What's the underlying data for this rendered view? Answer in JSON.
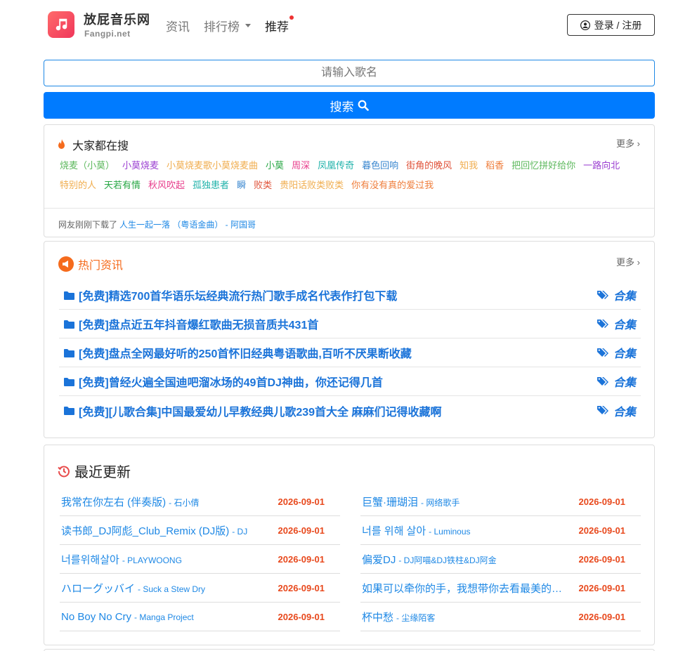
{
  "header": {
    "site_name": "放屁音乐网",
    "site_domain": "Fangpi.net",
    "nav": [
      {
        "label": "资讯"
      },
      {
        "label": "排行榜"
      },
      {
        "label": "推荐"
      }
    ],
    "login_label": "登录 / 注册"
  },
  "search": {
    "placeholder": "请输入歌名",
    "button_label": "搜索"
  },
  "hot_search": {
    "title": "大家都在搜",
    "more": "更多",
    "tags": [
      {
        "text": "烧麦（小莫）",
        "color": "#5cb85c"
      },
      {
        "text": "小莫烧麦",
        "color": "#9b3fd1"
      },
      {
        "text": "小莫烧麦歌小莫烧麦曲",
        "color": "#f0ad4e"
      },
      {
        "text": "小莫",
        "color": "#28a745"
      },
      {
        "text": "周深",
        "color": "#e83e8c"
      },
      {
        "text": "凤凰传奇",
        "color": "#20b2aa"
      },
      {
        "text": "暮色回响",
        "color": "#3a87cf"
      },
      {
        "text": "街角的晚风",
        "color": "#e0533a"
      },
      {
        "text": "知我",
        "color": "#f0ad4e"
      },
      {
        "text": "稻香",
        "color": "#ef7e3c"
      },
      {
        "text": "把回忆拼好给你",
        "color": "#5cb85c"
      },
      {
        "text": "一路向北",
        "color": "#9b3fd1"
      },
      {
        "text": "特别的人",
        "color": "#f0ad4e"
      },
      {
        "text": "天若有情",
        "color": "#28a745"
      },
      {
        "text": "秋风吹起",
        "color": "#e83e8c"
      },
      {
        "text": "孤独患者",
        "color": "#20b2aa"
      },
      {
        "text": "瞬",
        "color": "#3a87cf"
      },
      {
        "text": "败类",
        "color": "#e0533a"
      },
      {
        "text": "贵阳话败类败类",
        "color": "#f0ad4e"
      },
      {
        "text": "你有没有真的爱过我",
        "color": "#ef7e3c"
      }
    ],
    "recent_prefix": "网友刚刚下载了",
    "recent_song": "人生一起一落 （粤语金曲） - 阿国哥"
  },
  "news": {
    "title": "热门资讯",
    "more": "更多",
    "items": [
      {
        "title": "[免费]精选700首华语乐坛经典流行热门歌手成名代表作打包下载",
        "tag": "合集"
      },
      {
        "title": "[免费]盘点近五年抖音爆红歌曲无损音质共431首",
        "tag": "合集"
      },
      {
        "title": "[免费]盘点全网最好听的250首怀旧经典粤语歌曲,百听不厌果断收藏",
        "tag": "合集"
      },
      {
        "title": "[免费]曾经火遍全国迪吧溜冰场的49首DJ神曲，你还记得几首",
        "tag": "合集"
      },
      {
        "title": "[免费][儿歌合集]中国最爱幼儿早教经典儿歌239首大全 麻麻们记得收藏啊",
        "tag": "合集"
      }
    ]
  },
  "latest": {
    "title": "最近更新",
    "left": [
      {
        "title": "我常在你左右 (伴奏版)",
        "artist": "- 石小倩",
        "date": "2026-09-01"
      },
      {
        "title": "读书郎_DJ阿彪_Club_Remix (DJ版)",
        "artist": "- DJ",
        "date": "2026-09-01"
      },
      {
        "title": "너를위해살아",
        "artist": "- PLAYWOONG",
        "date": "2026-09-01"
      },
      {
        "title": "ハローグッバイ",
        "artist": "- Suck a Stew Dry",
        "date": "2026-09-01"
      },
      {
        "title": "No Boy No Cry",
        "artist": "- Manga Project",
        "date": "2026-09-01"
      }
    ],
    "right": [
      {
        "title": "巨蟹·珊瑚泪",
        "artist": "- 网络歌手",
        "date": "2026-09-01"
      },
      {
        "title": "너를 위해 살아",
        "artist": "- Luminous",
        "date": "2026-09-01"
      },
      {
        "title": "偏爱DJ",
        "artist": "- DJ阿喵&DJ铁柱&DJ阿金",
        "date": "2026-09-01"
      },
      {
        "title": "如果可以牵你的手，我想带你去看最美的风景",
        "artist": "",
        "date": "2026-09-01"
      },
      {
        "title": "杯中愁",
        "artist": "- 尘缘陌客",
        "date": "2026-09-01"
      }
    ]
  },
  "colors": {
    "primary": "#007bff",
    "link": "#1e88e5",
    "date": "#e8491d",
    "news_accent": "#f56b1d"
  }
}
